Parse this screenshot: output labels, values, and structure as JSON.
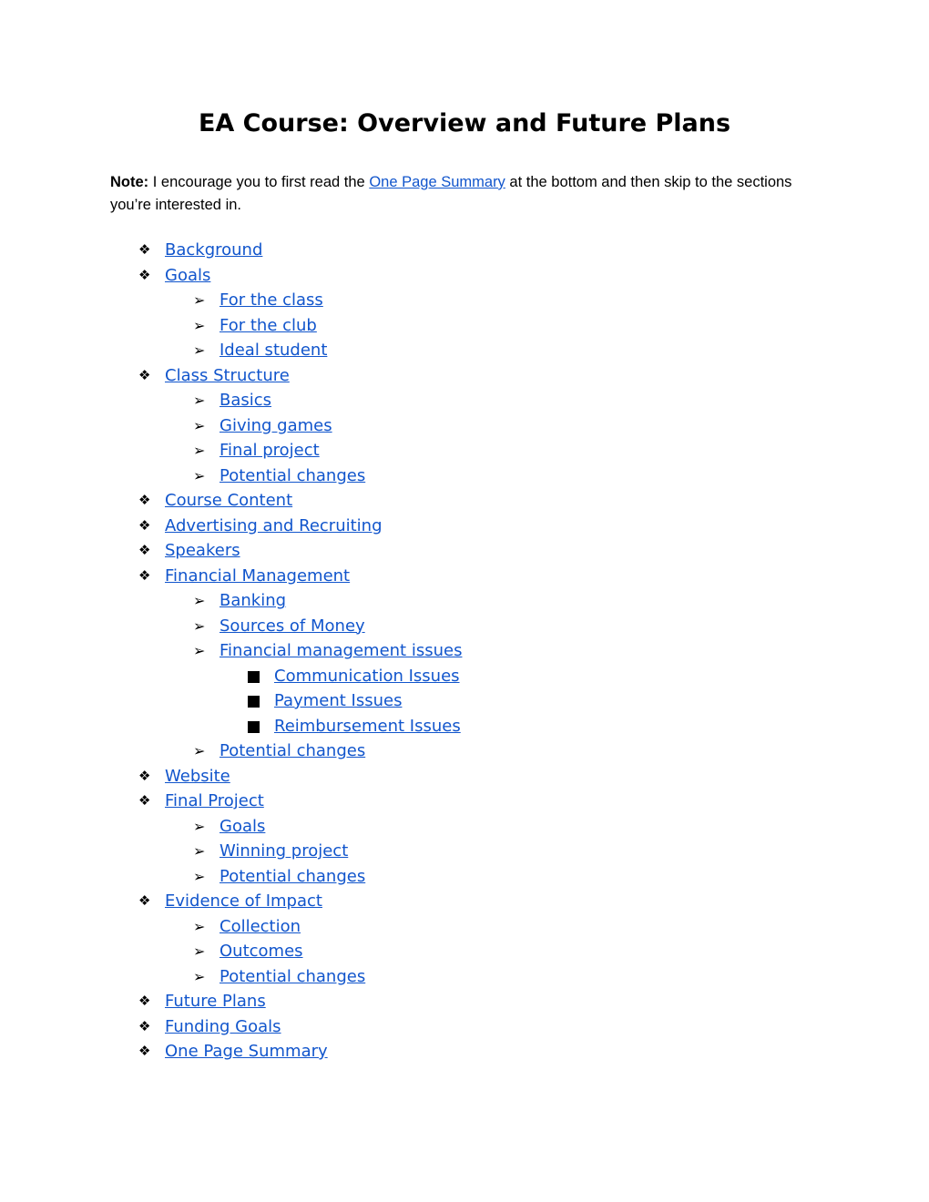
{
  "document": {
    "title": "EA Course: Overview and Future Plans",
    "note": {
      "label": "Note:",
      "text_before": " I encourage you to first read the ",
      "link": "One Page Summary",
      "text_after": " at the bottom and then skip to the sections you’re interested in."
    },
    "bullet_icons": {
      "level1": "❖",
      "level2": "➢",
      "level3": "■"
    },
    "toc": [
      {
        "level": 1,
        "label": "Background"
      },
      {
        "level": 1,
        "label": "Goals"
      },
      {
        "level": 2,
        "label": "For the class"
      },
      {
        "level": 2,
        "label": "For the club"
      },
      {
        "level": 2,
        "label": "Ideal student"
      },
      {
        "level": 1,
        "label": "Class Structure"
      },
      {
        "level": 2,
        "label": "Basics"
      },
      {
        "level": 2,
        "label": "Giving games"
      },
      {
        "level": 2,
        "label": "Final project"
      },
      {
        "level": 2,
        "label": "Potential changes"
      },
      {
        "level": 1,
        "label": "Course Content"
      },
      {
        "level": 1,
        "label": "Advertising and Recruiting"
      },
      {
        "level": 1,
        "label": "Speakers"
      },
      {
        "level": 1,
        "label": "Financial Management"
      },
      {
        "level": 2,
        "label": "Banking"
      },
      {
        "level": 2,
        "label": "Sources of Money"
      },
      {
        "level": 2,
        "label": "Financial management issues"
      },
      {
        "level": 3,
        "label": "Communication Issues"
      },
      {
        "level": 3,
        "label": "Payment Issues"
      },
      {
        "level": 3,
        "label": "Reimbursement Issues"
      },
      {
        "level": 2,
        "label": "Potential changes"
      },
      {
        "level": 1,
        "label": "Website"
      },
      {
        "level": 1,
        "label": "Final Project"
      },
      {
        "level": 2,
        "label": "Goals"
      },
      {
        "level": 2,
        "label": "Winning project"
      },
      {
        "level": 2,
        "label": "Potential changes"
      },
      {
        "level": 1,
        "label": "Evidence of Impact"
      },
      {
        "level": 2,
        "label": "Collection"
      },
      {
        "level": 2,
        "label": "Outcomes"
      },
      {
        "level": 2,
        "label": "Potential changes"
      },
      {
        "level": 1,
        "label": "Future Plans"
      },
      {
        "level": 1,
        "label": "Funding Goals"
      },
      {
        "level": 1,
        "label": "One Page Summary"
      }
    ]
  },
  "colors": {
    "link": "#1155cc",
    "text": "#000000"
  }
}
